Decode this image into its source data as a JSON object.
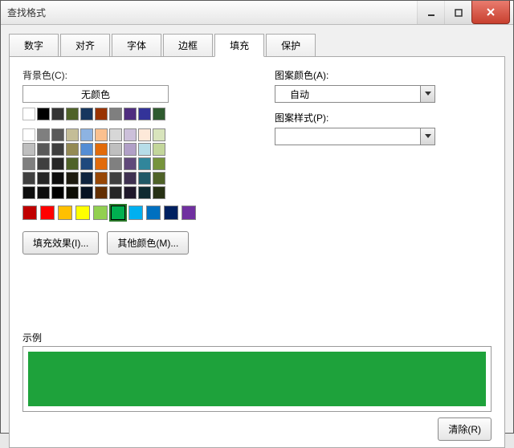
{
  "window": {
    "title": "查找格式"
  },
  "tabs": [
    "数字",
    "对齐",
    "字体",
    "边框",
    "填充",
    "保护"
  ],
  "activeTab": 4,
  "left": {
    "bgcolor_label": "背景色(C):",
    "no_color": "无颜色",
    "fill_effects": "填充效果(I)...",
    "more_colors": "其他颜色(M)..."
  },
  "right": {
    "pattern_color_label": "图案颜色(A):",
    "pattern_color_value": "自动",
    "pattern_style_label": "图案样式(P):",
    "pattern_style_value": ""
  },
  "example": {
    "label": "示例",
    "color": "#1ea23b"
  },
  "clear": "清除(R)",
  "palette": {
    "row1": [
      "#ffffff",
      "#000000",
      "#333333",
      "#4f6228",
      "#17375e",
      "#993300",
      "#7f7f7f",
      "#4f2d7f",
      "#333399",
      "#2f5b2f"
    ],
    "row3": [
      "#ffffff",
      "#7f7f7f",
      "#595959",
      "#c4bd97",
      "#8db3e2",
      "#fac08f",
      "#d7d7d7",
      "#ccc0da",
      "#fde9d9",
      "#d8e4bc"
    ],
    "row4": [
      "#bfbfbf",
      "#595959",
      "#3f3f3f",
      "#948a54",
      "#548dd4",
      "#e26b0a",
      "#bfbfbf",
      "#b1a0c7",
      "#b7dde8",
      "#c3d69b"
    ],
    "row5": [
      "#7f7f7f",
      "#3f3f3f",
      "#262626",
      "#4f6228",
      "#1f497d",
      "#e26b0a",
      "#808080",
      "#60497a",
      "#31869b",
      "#76933c"
    ],
    "row6": [
      "#404040",
      "#262626",
      "#0d0d0d",
      "#1d1b10",
      "#0f243e",
      "#974706",
      "#404040",
      "#3f3151",
      "#215967",
      "#4f6228"
    ],
    "row7": [
      "#0d0d0d",
      "#0d0d0d",
      "#000000",
      "#0c0c04",
      "#061222",
      "#632f02",
      "#262626",
      "#1f182a",
      "#0f2a31",
      "#273114"
    ],
    "standard": [
      "#c00000",
      "#ff0000",
      "#ffc000",
      "#ffff00",
      "#92d050",
      "#00b050",
      "#00b0f0",
      "#0070c0",
      "#002060",
      "#7030a0"
    ]
  },
  "selectedStandardIndex": 5
}
